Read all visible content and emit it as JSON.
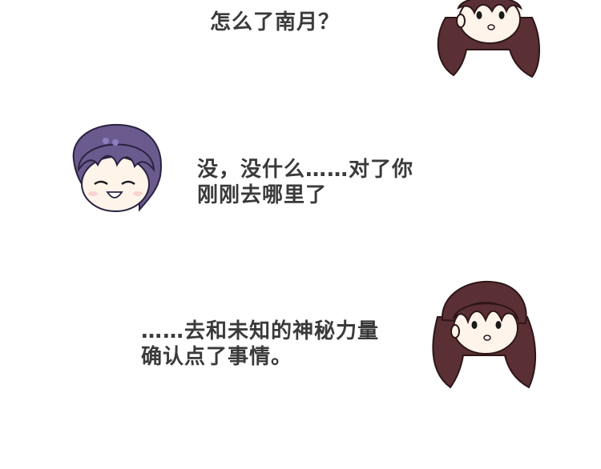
{
  "dialogue": [
    {
      "speaker": "brown-hair-girl",
      "lines": [
        "怎么了南月？"
      ]
    },
    {
      "speaker": "purple-hair-girl",
      "lines": [
        "没，没什么……对了你",
        "刚刚去哪里了"
      ]
    },
    {
      "speaker": "brown-hair-girl",
      "lines": [
        "……去和未知的神秘力量",
        "确认点了事情。"
      ]
    }
  ],
  "colors": {
    "text": "#3a3a3a",
    "brown_hair": "#5a3034",
    "purple_hair": "#6b5a8e",
    "skin": "#fff4ea"
  },
  "icons": [
    "brown-hair-girl-face",
    "purple-hair-girl-face",
    "brown-hair-girl-face"
  ]
}
